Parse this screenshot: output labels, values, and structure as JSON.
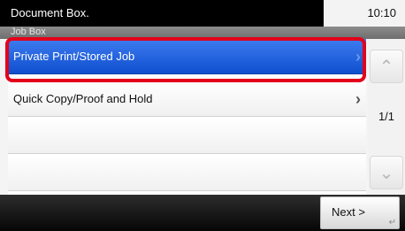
{
  "header": {
    "title": "Document Box.",
    "time": "10:10"
  },
  "subheader": {
    "title": "Job Box"
  },
  "list": {
    "items": [
      {
        "label": "Private Print/Stored Job",
        "selected": true
      },
      {
        "label": "Quick Copy/Proof and Hold",
        "selected": false
      },
      {
        "label": "",
        "selected": false
      },
      {
        "label": "",
        "selected": false
      }
    ]
  },
  "scroll": {
    "page_indicator": "1/1",
    "up_icon": "chevron-up-icon",
    "down_icon": "chevron-down-icon"
  },
  "footer": {
    "next_label": "Next >"
  },
  "colors": {
    "selected": "#1a5fe0",
    "highlight": "#e3001b",
    "title_bar": "#000000"
  }
}
